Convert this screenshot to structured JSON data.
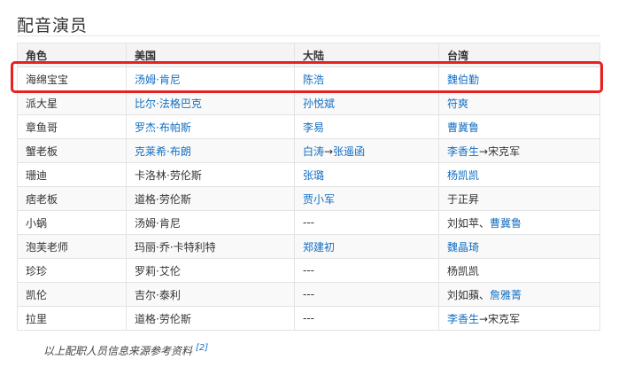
{
  "section_title": "配音演员",
  "table": {
    "headers": [
      "角色",
      "美国",
      "大陆",
      "台湾"
    ],
    "rows": [
      [
        {
          "t": "海绵宝宝"
        },
        {
          "t": "汤姆·肯尼",
          "link": true
        },
        {
          "t": "陈浩",
          "link": true
        },
        {
          "t": "魏伯勤",
          "link": true
        }
      ],
      [
        {
          "t": "派大星"
        },
        {
          "t": "比尔·法格巴克",
          "link": true
        },
        {
          "t": "孙悦斌",
          "link": true
        },
        {
          "t": "符爽",
          "link": true
        }
      ],
      [
        {
          "t": "章鱼哥"
        },
        {
          "t": "罗杰·布帕斯",
          "link": true
        },
        {
          "t": "李易",
          "link": true
        },
        {
          "t": "曹冀鲁",
          "link": true
        }
      ],
      [
        {
          "t": "蟹老板"
        },
        {
          "t": "克莱希·布朗",
          "link": true
        },
        [
          {
            "t": "白涛",
            "link": true
          },
          {
            "t": "→"
          },
          {
            "t": "张遥函",
            "link": true
          }
        ],
        [
          {
            "t": "李香生",
            "link": true
          },
          {
            "t": "→宋克军"
          }
        ]
      ],
      [
        {
          "t": "珊迪"
        },
        {
          "t": "卡洛林·劳伦斯"
        },
        {
          "t": "张璐",
          "link": true
        },
        {
          "t": "杨凯凯",
          "link": true
        }
      ],
      [
        {
          "t": "痞老板"
        },
        {
          "t": "道格·劳伦斯"
        },
        {
          "t": "贾小军",
          "link": true
        },
        {
          "t": "于正昇"
        }
      ],
      [
        {
          "t": "小蜗"
        },
        {
          "t": "汤姆·肯尼"
        },
        {
          "t": "---"
        },
        [
          {
            "t": "刘如苹、"
          },
          {
            "t": "曹冀鲁",
            "link": true
          }
        ]
      ],
      [
        {
          "t": "泡芙老师"
        },
        {
          "t": "玛丽·乔·卡特利特"
        },
        {
          "t": "郑建初",
          "link": true
        },
        {
          "t": "魏晶琦",
          "link": true
        }
      ],
      [
        {
          "t": "珍珍"
        },
        {
          "t": "罗莉·艾伦"
        },
        {
          "t": "---"
        },
        {
          "t": "杨凯凯"
        }
      ],
      [
        {
          "t": "凯伦"
        },
        {
          "t": "吉尔·泰利"
        },
        {
          "t": "---"
        },
        [
          {
            "t": "刘如蘋、"
          },
          {
            "t": "詹雅菁",
            "link": true
          }
        ]
      ],
      [
        {
          "t": "拉里"
        },
        {
          "t": "道格·劳伦斯"
        },
        {
          "t": "---"
        },
        [
          {
            "t": "李香生",
            "link": true
          },
          {
            "t": "→宋克军"
          }
        ]
      ]
    ]
  },
  "footnote": {
    "text": "以上配职人员信息来源参考资料",
    "ref": "[2]"
  },
  "colors": {
    "link": "#136ec2",
    "highlight": "#e8201f",
    "header_bg": "#f4f4f4",
    "border": "#e3e3e3"
  }
}
